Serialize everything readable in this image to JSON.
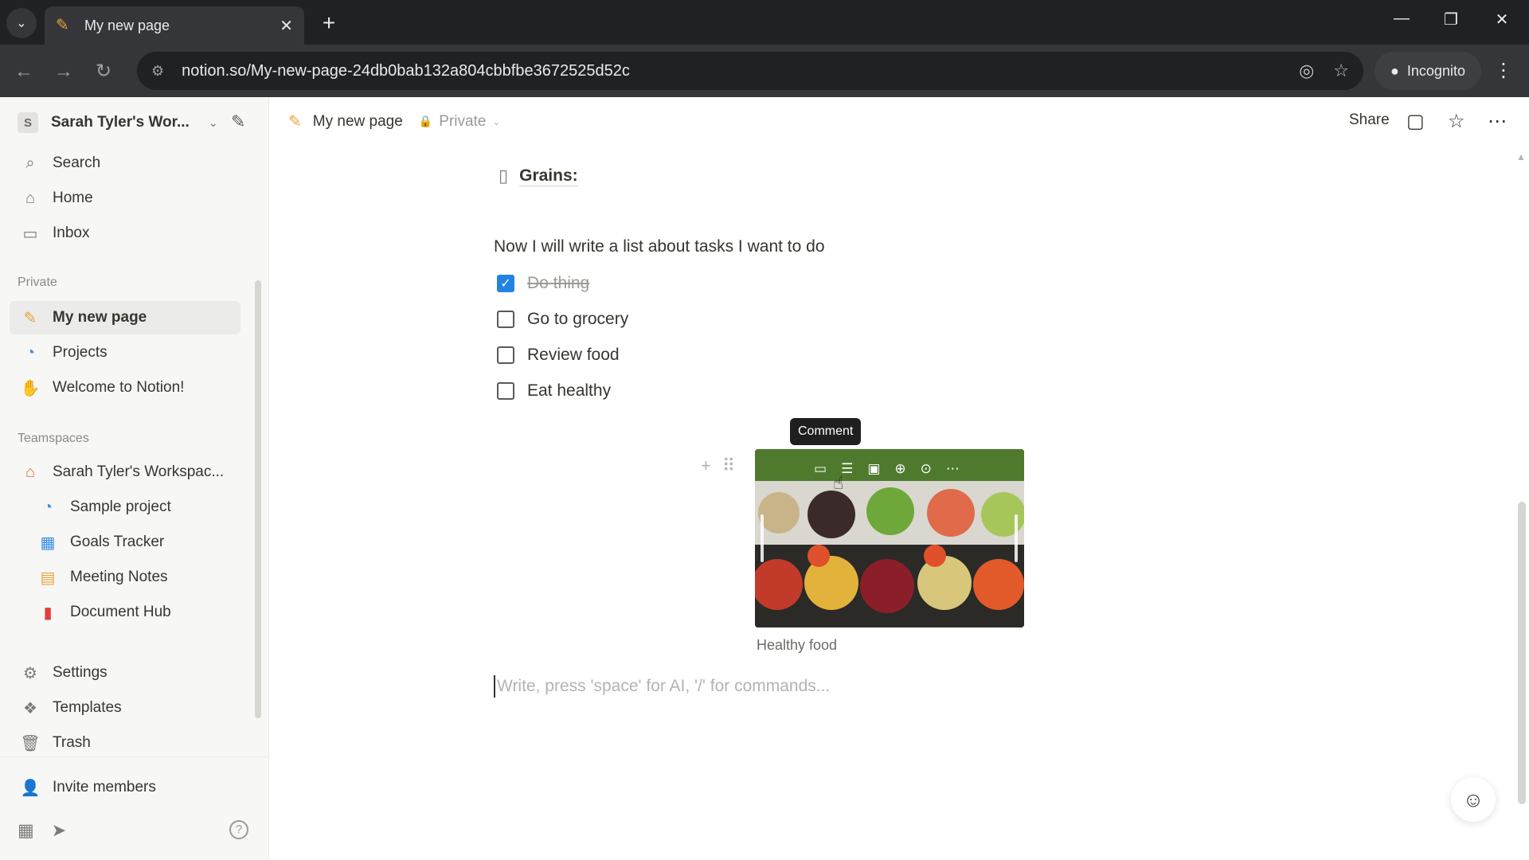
{
  "browser": {
    "tab_title": "My new page",
    "url": "notion.so/My-new-page-24db0bab132a804cbbfbe3672525d52c",
    "incognito_label": "Incognito"
  },
  "sidebar": {
    "workspace_initial": "S",
    "workspace_name": "Sarah Tyler's Wor...",
    "top_items": [
      {
        "label": "Search",
        "icon": "search-icon"
      },
      {
        "label": "Home",
        "icon": "home-icon"
      },
      {
        "label": "Inbox",
        "icon": "inbox-icon"
      }
    ],
    "private_label": "Private",
    "private_items": [
      {
        "label": "My new page",
        "icon": "pencil-icon"
      },
      {
        "label": "Projects",
        "icon": "projects-icon"
      },
      {
        "label": "Welcome to Notion!",
        "icon": "wave-icon"
      }
    ],
    "teamspaces_label": "Teamspaces",
    "teamspace_items": [
      {
        "label": "Sarah Tyler's Workspac...",
        "icon": "house-icon"
      },
      {
        "label": "Sample project",
        "icon": "projects-icon"
      },
      {
        "label": "Goals Tracker",
        "icon": "chart-icon"
      },
      {
        "label": "Meeting Notes",
        "icon": "calendar-icon"
      },
      {
        "label": "Document Hub",
        "icon": "document-icon"
      }
    ],
    "bottom_items": [
      {
        "label": "Settings",
        "icon": "gear-icon"
      },
      {
        "label": "Templates",
        "icon": "templates-icon"
      },
      {
        "label": "Trash",
        "icon": "trash-icon"
      }
    ],
    "invite_label": "Invite members"
  },
  "topbar": {
    "page_title": "My new page",
    "privacy": "Private",
    "share_label": "Share"
  },
  "content": {
    "subpage_title": "Grains:",
    "paragraph": "Now I will write a list about tasks I want to do",
    "todos": [
      {
        "label": "Do thing",
        "checked": true
      },
      {
        "label": "Go to grocery",
        "checked": false
      },
      {
        "label": "Review food",
        "checked": false
      },
      {
        "label": "Eat healthy",
        "checked": false
      }
    ],
    "tooltip": "Comment",
    "image_caption": "Healthy food",
    "editor_placeholder": "Write, press 'space' for AI, '/' for commands..."
  },
  "colors": {
    "accent_blue": "#2383e2",
    "sidebar_bg": "#f7f7f5",
    "chrome_dark": "#202124"
  }
}
